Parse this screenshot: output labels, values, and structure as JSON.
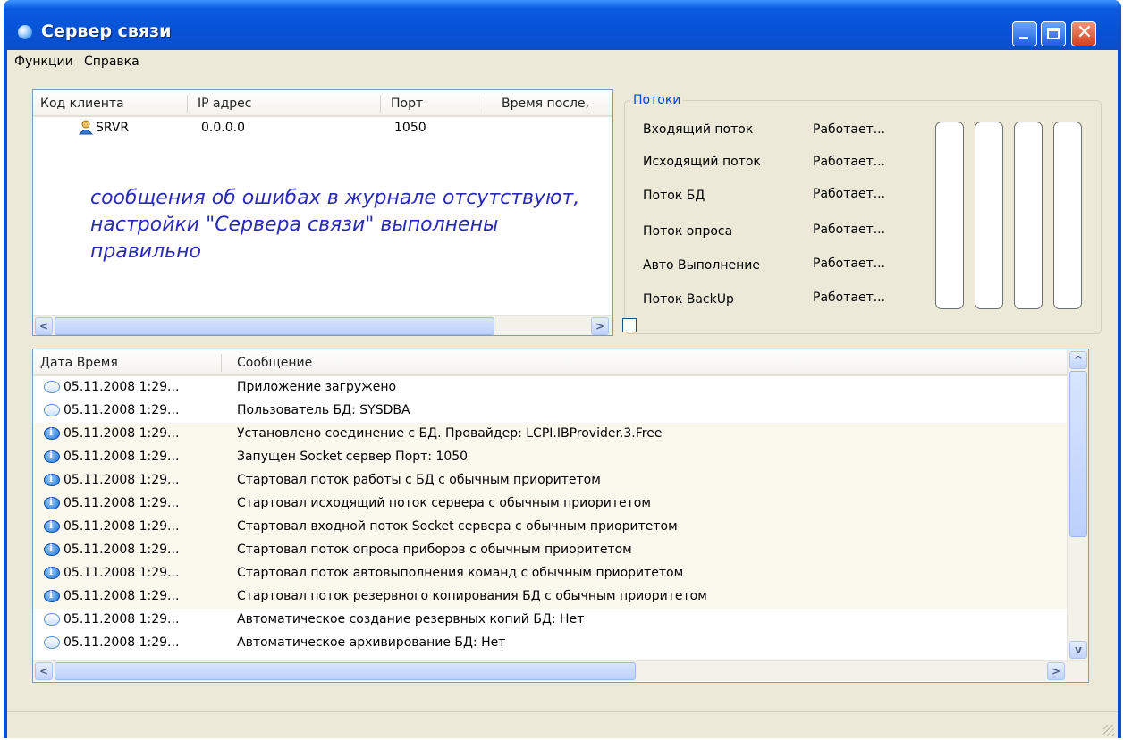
{
  "window": {
    "title": "Сервер связи"
  },
  "menu": [
    "Функции",
    "Справка"
  ],
  "clients": {
    "columns": [
      "Код клиента",
      "IP адрес",
      "Порт",
      "Время после,"
    ],
    "rows": [
      {
        "code": "SRVR",
        "ip": "0.0.0.0",
        "port": "1050",
        "time": ""
      }
    ],
    "note": "сообщения об ошибах в журнале отсутствуют, настройки \"Сервера связи\" выполнены правильно"
  },
  "threads": {
    "title": "Потоки",
    "items": [
      {
        "name": "Входящий поток",
        "status": "Работает..."
      },
      {
        "name": "Исходящий поток",
        "status": "Работает..."
      },
      {
        "name": "Поток БД",
        "status": "Работает..."
      },
      {
        "name": "Поток опроса",
        "status": "Работает..."
      },
      {
        "name": "Авто Выполнение",
        "status": "Работает..."
      },
      {
        "name": "Поток BackUp",
        "status": "Работает..."
      }
    ]
  },
  "log": {
    "columns": [
      "Дата Время",
      "Сообщение"
    ],
    "rows": [
      {
        "date": "05.11.2008 1:29...",
        "msg": "Приложение загружено",
        "icon": "message-bubble-icon"
      },
      {
        "date": "05.11.2008 1:29...",
        "msg": "Пользователь БД: SYSDBA",
        "icon": "message-bubble-icon"
      },
      {
        "date": "05.11.2008 1:29...",
        "msg": "Установлено соединение с БД. Провайдер: LCPI.IBProvider.3.Free",
        "icon": "info-bubble-icon"
      },
      {
        "date": "05.11.2008 1:29...",
        "msg": "Запущен Socket сервер Порт: 1050",
        "icon": "info-bubble-icon"
      },
      {
        "date": "05.11.2008 1:29...",
        "msg": "Стартовал поток работы с БД с обычным приоритетом",
        "icon": "info-bubble-icon"
      },
      {
        "date": "05.11.2008 1:29...",
        "msg": "Стартовал исходящий поток сервера с обычным приоритетом",
        "icon": "info-bubble-icon"
      },
      {
        "date": "05.11.2008 1:29...",
        "msg": "Стартовал входной поток Socket сервера с обычным приоритетом",
        "icon": "info-bubble-icon"
      },
      {
        "date": "05.11.2008 1:29...",
        "msg": "Стартовал поток опроса приборов с обычным приоритетом",
        "icon": "info-bubble-icon"
      },
      {
        "date": "05.11.2008 1:29...",
        "msg": "Стартовал поток автовыполнения команд с обычным приоритетом",
        "icon": "info-bubble-icon"
      },
      {
        "date": "05.11.2008 1:29...",
        "msg": "Стартовал поток резервного копирования БД с обычным приоритетом",
        "icon": "info-bubble-icon"
      },
      {
        "date": "05.11.2008 1:29...",
        "msg": "Автоматическое создание резервных копий БД: Нет",
        "icon": "message-bubble-icon"
      },
      {
        "date": "05.11.2008 1:29...",
        "msg": "Автоматическое архивирование БД: Нет",
        "icon": "message-bubble-icon"
      }
    ]
  }
}
